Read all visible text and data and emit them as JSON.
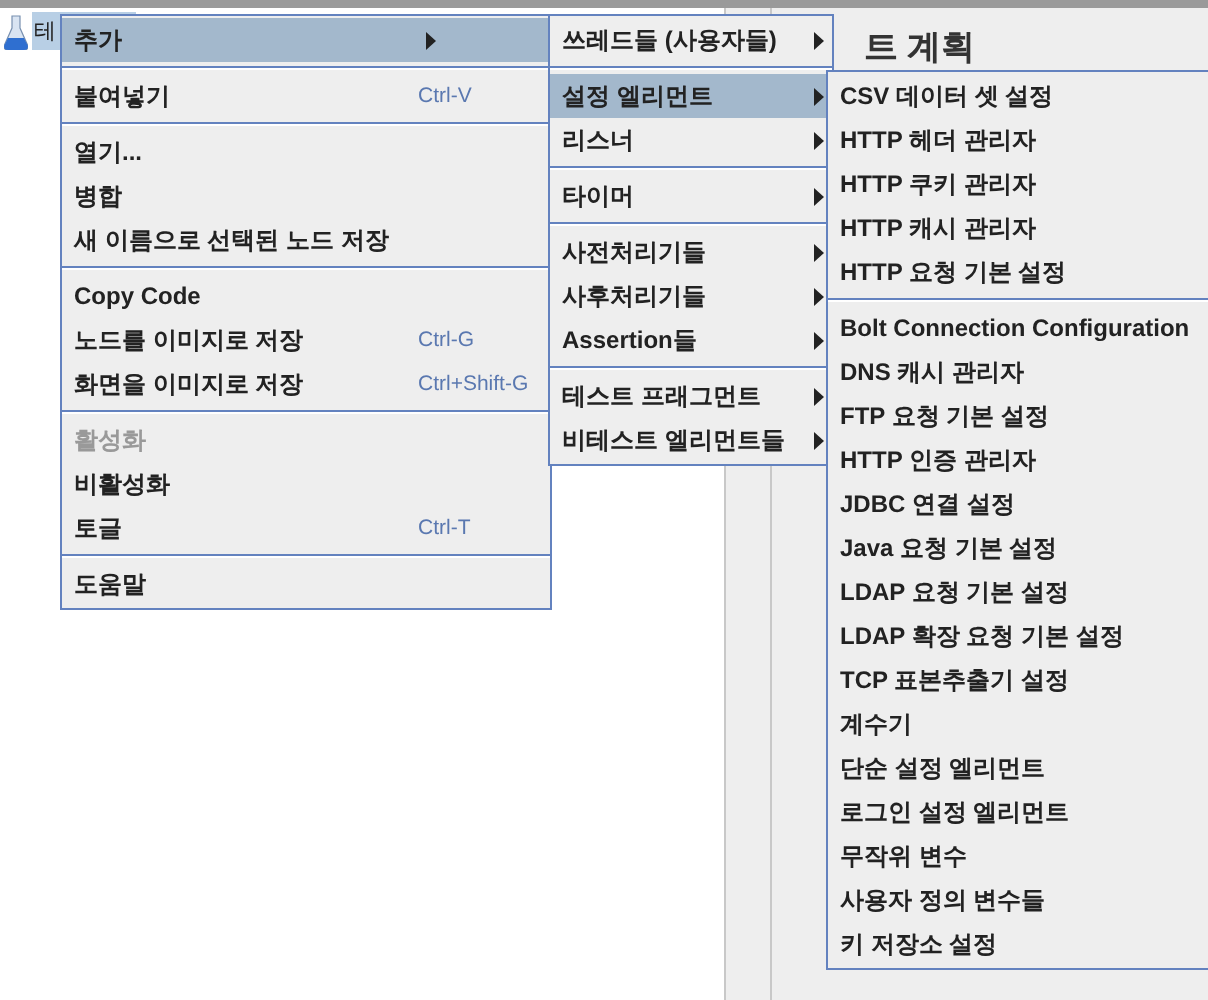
{
  "tree": {
    "node_label": "테"
  },
  "panel": {
    "title": "트 계획"
  },
  "menus": [
    {
      "items": [
        {
          "kind": "item",
          "label": "추가",
          "selected": true,
          "submenu": true
        },
        {
          "kind": "separator"
        },
        {
          "kind": "item",
          "label": "붙여넣기",
          "shortcut": "Ctrl-V",
          "selected": false
        },
        {
          "kind": "separator"
        },
        {
          "kind": "item",
          "label": "열기...",
          "selected": false
        },
        {
          "kind": "item",
          "label": "병합",
          "selected": false
        },
        {
          "kind": "item",
          "label": "새 이름으로 선택된 노드 저장",
          "selected": false
        },
        {
          "kind": "separator"
        },
        {
          "kind": "item",
          "label": "Copy Code",
          "selected": false
        },
        {
          "kind": "item",
          "label": "노드를 이미지로 저장",
          "shortcut": "Ctrl-G",
          "selected": false
        },
        {
          "kind": "item",
          "label": "화면을 이미지로 저장",
          "shortcut": "Ctrl+Shift-G",
          "selected": false
        },
        {
          "kind": "separator"
        },
        {
          "kind": "item",
          "label": "활성화",
          "selected": false,
          "disabled": true
        },
        {
          "kind": "item",
          "label": "비활성화",
          "selected": false
        },
        {
          "kind": "item",
          "label": "토글",
          "shortcut": "Ctrl-T",
          "selected": false
        },
        {
          "kind": "separator"
        },
        {
          "kind": "item",
          "label": "도움말",
          "selected": false
        }
      ]
    },
    {
      "items": [
        {
          "kind": "item",
          "label": "쓰레드들 (사용자들)",
          "selected": false,
          "submenu": true
        },
        {
          "kind": "separator"
        },
        {
          "kind": "item",
          "label": "설정 엘리먼트",
          "selected": true,
          "submenu": true
        },
        {
          "kind": "item",
          "label": "리스너",
          "selected": false,
          "submenu": true
        },
        {
          "kind": "separator"
        },
        {
          "kind": "item",
          "label": "타이머",
          "selected": false,
          "submenu": true
        },
        {
          "kind": "separator"
        },
        {
          "kind": "item",
          "label": "사전처리기들",
          "selected": false,
          "submenu": true
        },
        {
          "kind": "item",
          "label": "사후처리기들",
          "selected": false,
          "submenu": true
        },
        {
          "kind": "item",
          "label": "Assertion들",
          "selected": false,
          "submenu": true
        },
        {
          "kind": "separator"
        },
        {
          "kind": "item",
          "label": "테스트 프래그먼트",
          "selected": false,
          "submenu": true
        },
        {
          "kind": "item",
          "label": "비테스트 엘리먼트들",
          "selected": false,
          "submenu": true
        }
      ]
    },
    {
      "items": [
        {
          "kind": "item",
          "label": "CSV 데이터 셋 설정",
          "selected": false
        },
        {
          "kind": "item",
          "label": "HTTP 헤더 관리자",
          "selected": false
        },
        {
          "kind": "item",
          "label": "HTTP 쿠키 관리자",
          "selected": false
        },
        {
          "kind": "item",
          "label": "HTTP 캐시 관리자",
          "selected": false
        },
        {
          "kind": "item",
          "label": "HTTP 요청 기본 설정",
          "selected": false
        },
        {
          "kind": "separator"
        },
        {
          "kind": "item",
          "label": "Bolt Connection Configuration",
          "selected": false
        },
        {
          "kind": "item",
          "label": "DNS 캐시 관리자",
          "selected": false
        },
        {
          "kind": "item",
          "label": "FTP 요청 기본 설정",
          "selected": false
        },
        {
          "kind": "item",
          "label": "HTTP 인증 관리자",
          "selected": false
        },
        {
          "kind": "item",
          "label": "JDBC 연결 설정",
          "selected": false
        },
        {
          "kind": "item",
          "label": "Java 요청 기본 설정",
          "selected": false
        },
        {
          "kind": "item",
          "label": "LDAP 요청 기본 설정",
          "selected": false
        },
        {
          "kind": "item",
          "label": "LDAP 확장 요청 기본 설정",
          "selected": false
        },
        {
          "kind": "item",
          "label": "TCP 표본추출기 설정",
          "selected": false
        },
        {
          "kind": "item",
          "label": "계수기",
          "selected": false
        },
        {
          "kind": "item",
          "label": "단순 설정 엘리먼트",
          "selected": false
        },
        {
          "kind": "item",
          "label": "로그인 설정 엘리먼트",
          "selected": false
        },
        {
          "kind": "item",
          "label": "무작위 변수",
          "selected": false
        },
        {
          "kind": "item",
          "label": "사용자 정의 변수들",
          "selected": false
        },
        {
          "kind": "item",
          "label": "키 저장소 설정",
          "selected": false
        }
      ]
    }
  ]
}
